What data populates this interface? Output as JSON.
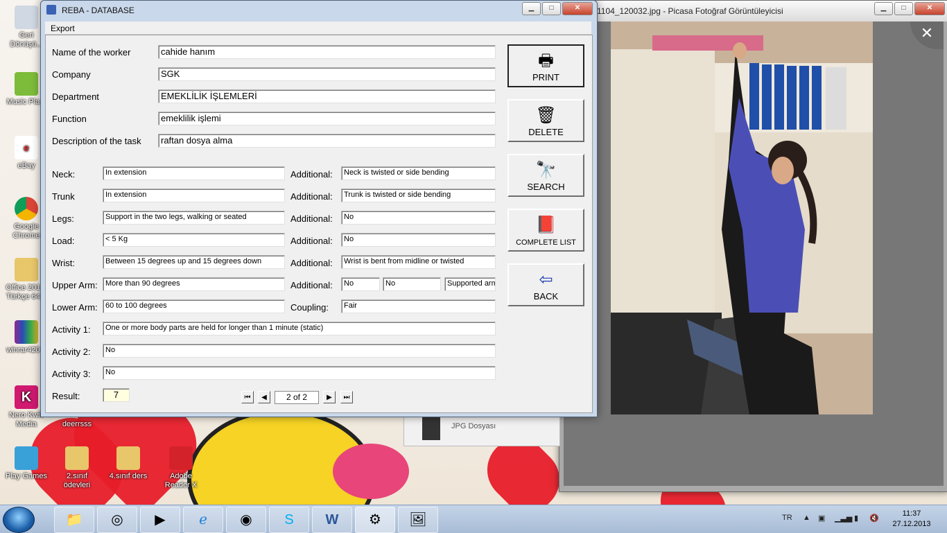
{
  "desktop": {
    "icons": [
      {
        "label": "Geri Dönüşü..."
      },
      {
        "label": "Music Pla..."
      },
      {
        "label": "eBay"
      },
      {
        "label": "Google Chrome"
      },
      {
        "label": "Office 201... Türkçe 64..."
      },
      {
        "label": "winrar420..."
      },
      {
        "label": "Nero Kwik Media"
      },
      {
        "label": "Play Games"
      },
      {
        "label": "2.sınıf ödevleri"
      },
      {
        "label": "4.sınıf ders"
      },
      {
        "label": "Adobe Reader X"
      },
      {
        "label": "deerrsss"
      }
    ]
  },
  "picasa": {
    "title": "1104_120032.jpg - Picasa Fotoğraf Görüntüleyicisi",
    "close_glyph": "✕",
    "jpg_label": "JPG Dosyası"
  },
  "reba": {
    "title": "REBA - DATABASE",
    "menu": {
      "export": "Export"
    },
    "fields": {
      "worker_label": "Name of the worker",
      "worker": "cahide hanım",
      "company_label": "Company",
      "company": "SGK",
      "department_label": "Department",
      "department": "EMEKLİLİK İŞLEMLERİ",
      "function_label": "Function",
      "function": "emeklilik işlemi",
      "task_label": "Description of the task",
      "task": "raftan dosya alma"
    },
    "rows": {
      "neck_label": "Neck:",
      "neck": "In extension",
      "neck_add_label": "Additional:",
      "neck_add": "Neck is twisted or side bending",
      "trunk_label": "Trunk",
      "trunk": "In extension",
      "trunk_add_label": "Additional:",
      "trunk_add": "Trunk is twisted or side bending",
      "legs_label": "Legs:",
      "legs": "Support in the two legs, walking or seated",
      "legs_add_label": "Additional:",
      "legs_add": "No",
      "load_label": "Load:",
      "load": "< 5 Kg",
      "load_add_label": "Additional:",
      "load_add": "No",
      "wrist_label": "Wrist:",
      "wrist": "Between 15 degrees up and 15 degrees down",
      "wrist_add_label": "Additional:",
      "wrist_add": "Wrist is bent from midline or twisted",
      "upper_label": "Upper Arm:",
      "upper": "More than 90 degrees",
      "upper_add_label": "Additional:",
      "upper_add1": "No",
      "upper_add2": "No",
      "upper_add3": "Supported arm",
      "lower_label": "Lower Arm:",
      "lower": "60 to 100 degrees",
      "coupling_label": "Coupling:",
      "coupling": "Fair",
      "act1_label": "Activity 1:",
      "act1": "One or more body parts are held for longer than 1 minute (static)",
      "act2_label": "Activity 2:",
      "act2": "No",
      "act3_label": "Activity 3:",
      "act3": "No",
      "result_label": "Result:",
      "result": "7"
    },
    "buttons": {
      "print": "PRINT",
      "delete": "DELETE",
      "search": "SEARCH",
      "list": "COMPLETE LIST",
      "back": "BACK"
    },
    "nav": {
      "position": "2 of 2"
    }
  },
  "taskbar": {
    "lang": "TR",
    "time": "11:37",
    "date": "27.12.2013"
  }
}
